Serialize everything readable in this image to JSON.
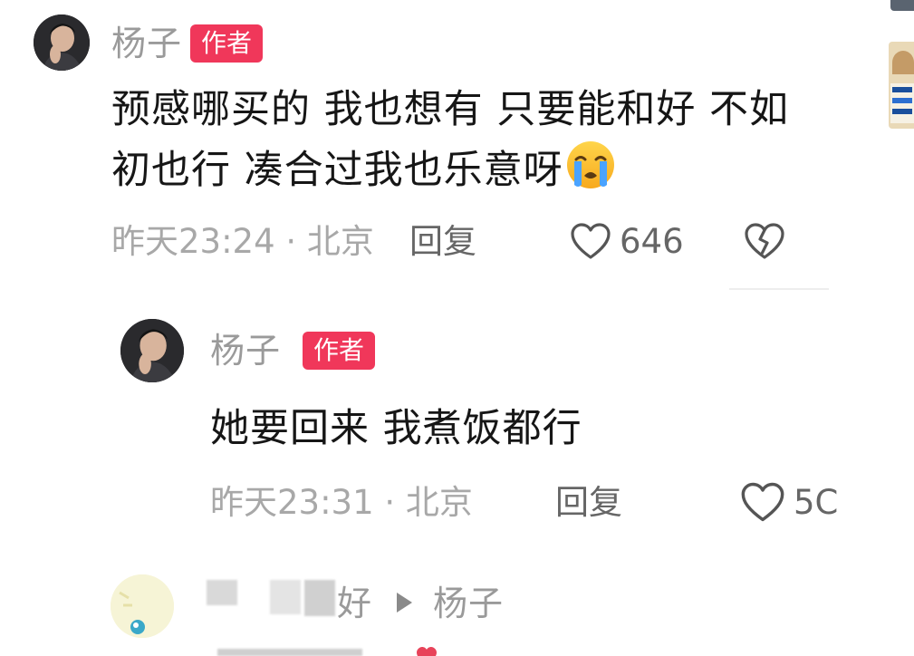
{
  "comments": [
    {
      "author": "杨子",
      "badge": "作者",
      "text_line1": "预感哪买的 我也想有 只要能和好 不如",
      "text_line2": "初也行 凑合过我也乐意呀",
      "emoji": "crying-face-icon",
      "meta": "昨天23:24 · 北京",
      "reply_label": "回复",
      "likes": "646"
    },
    {
      "author": "杨子",
      "badge": "作者",
      "text": "她要回来 我煮饭都行",
      "meta": "昨天23:31 · 北京",
      "reply_label": "回复",
      "likes": "5C"
    },
    {
      "author_suffix": "好",
      "reply_to": "杨子"
    }
  ],
  "colors": {
    "badge": "#f0375a",
    "name": "#9a9a9a",
    "meta": "#a8a8a8",
    "action": "#666666"
  }
}
